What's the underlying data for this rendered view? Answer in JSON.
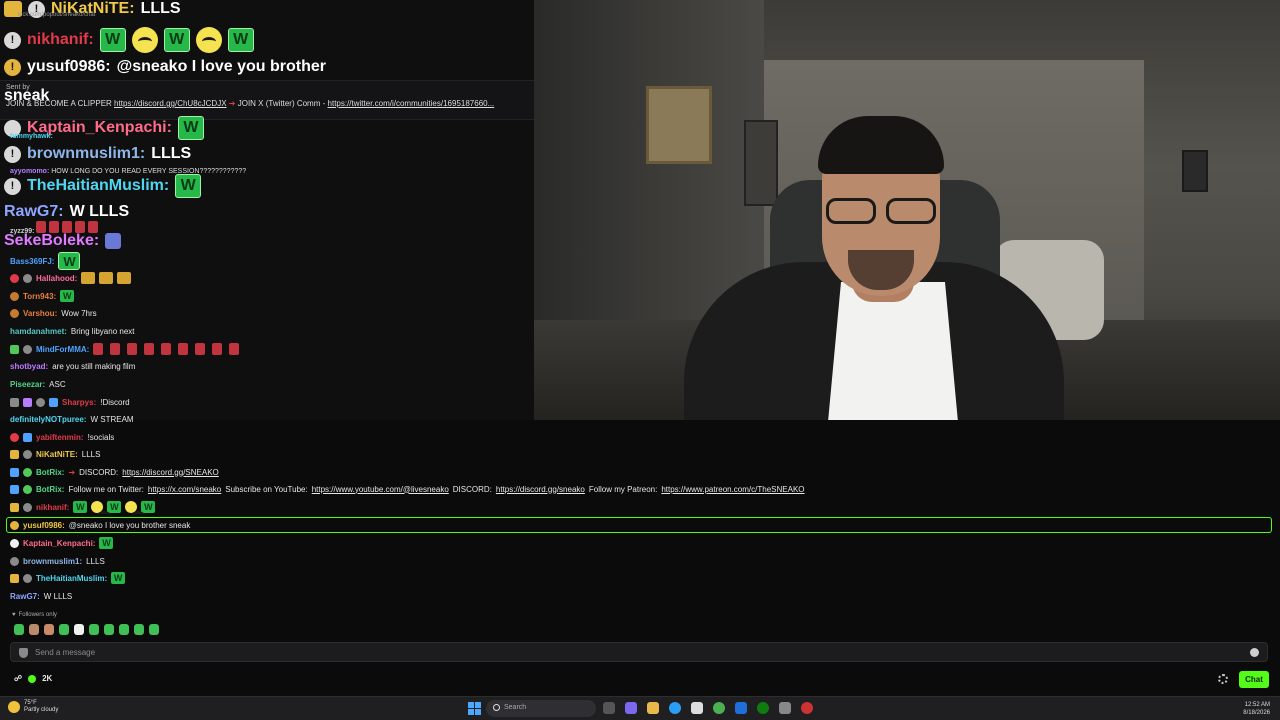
{
  "popout": {
    "url": "kick.com/popout/sneako/chat",
    "lines": [
      {
        "user": "NiKatNiTE:",
        "msg": "LLLS",
        "color": "#f0c94a"
      },
      {
        "user": "nikhanif:",
        "msg": "",
        "color": "#e23a4a"
      },
      {
        "user": "yusuf0986:",
        "msg": "@sneako I love you brother",
        "color": "#ffffff"
      }
    ],
    "banner": {
      "sent_by": "Sent by",
      "word": "sneak",
      "pinned_text": "JOIN & BECOME A CLIPPER",
      "pinned_link1": "https://discord.gg/ChU8cJCDJX",
      "pinned_mid": "JOIN X (Twitter) Comm -",
      "pinned_link2": "https://twitter.com/i/communities/1695187660..."
    },
    "big_lines": [
      {
        "user": "Kaptain_Kenpachi:",
        "msg": "",
        "color": "#ff6b8a"
      },
      {
        "user": "brownmuslim1:",
        "msg": "LLLS",
        "color": "#8fb6e8"
      },
      {
        "user": "TheHaitianMuslim:",
        "msg": "",
        "color": "#4fd6f0"
      },
      {
        "user": "RawG7:",
        "msg": "W LLLS",
        "color": "#8ea6ff"
      },
      {
        "user": "SekeBoleke:",
        "msg": "",
        "color": "#e07aff"
      }
    ],
    "small": [
      {
        "user": "tummyhawk:",
        "msg": ""
      },
      {
        "user": "ayyomomo:",
        "msg": "HOW LONG DO YOU READ EVERY SESSION????????????"
      },
      {
        "user": "zyzz99:",
        "msg": ""
      }
    ]
  },
  "chat": {
    "rows": [
      {
        "user": "Bass369FJ:",
        "msg": "",
        "color": "#4fa3ff"
      },
      {
        "user": "Hallahood:",
        "msg": "",
        "color": "#ff6b9a"
      },
      {
        "user": "Torn943:",
        "msg": "",
        "color": "#e87d3e"
      },
      {
        "user": "Varshou:",
        "msg": "Wow 7hrs",
        "color": "#e87d3e"
      },
      {
        "user": "hamdanahmet:",
        "msg": "Bring libyano next",
        "color": "#53c7c7"
      },
      {
        "user": "MindForMMA:",
        "msg": "",
        "color": "#4fa3ff"
      },
      {
        "user": "shotbyad:",
        "msg": "are you still making film",
        "color": "#b87cff"
      },
      {
        "user": "Piseezar:",
        "msg": "ASC",
        "color": "#53d68a"
      },
      {
        "user": "Sharpys:",
        "msg": "!Discord",
        "color": "#e23a4a"
      },
      {
        "user": "definitelyNOTpuree:",
        "msg": "W STREAM",
        "color": "#4fd6f0"
      },
      {
        "user": "yabiftenmin:",
        "msg": "!socials",
        "color": "#e23a4a"
      },
      {
        "user": "NiKatNiTE:",
        "msg": "LLLS",
        "color": "#f0c94a"
      }
    ],
    "botrix1": {
      "user": "BotRix:",
      "msg": "DISCORD:",
      "link": "https://discord.gg/SNEAKO"
    },
    "botrix2": {
      "user": "BotRix:",
      "p1": "Follow me on Twitter:",
      "l1": "https://x.com/sneako",
      "p2": "Subscribe on YouTube:",
      "l2": "https://www.youtube.com/@livesneako",
      "p3": "DISCORD:",
      "l3": "https://discord.gg/sneako",
      "p4": "Follow my Patreon:",
      "l4": "https://www.patreon.com/c/TheSNEAKO"
    },
    "nikhanif": {
      "user": "nikhanif:",
      "msg": ""
    },
    "highlighted": {
      "user": "yusuf0986:",
      "msg": "@sneako I love you brother sneak"
    },
    "after": [
      {
        "user": "Kaptain_Kenpachi:",
        "msg": "",
        "color": "#ff6b8a"
      },
      {
        "user": "brownmuslim1:",
        "msg": "LLLS",
        "color": "#8fb6e8"
      },
      {
        "user": "TheHaitianMuslim:",
        "msg": "",
        "color": "#4fd6f0"
      },
      {
        "user": "RawG7:",
        "msg": "W LLLS",
        "color": "#8ea6ff"
      }
    ],
    "followers_only": "Followers only",
    "placeholder": "Send a message",
    "viewers": "2K",
    "chat_button": "Chat"
  },
  "taskbar": {
    "temp": "75°F",
    "weather": "Partly cloudy",
    "search": "Search",
    "time": "12:52 AM",
    "date": "8/18/2026"
  },
  "colors": {
    "accent": "#53fc18",
    "emote_green": "#27b84a",
    "bg": "#0b0b0c"
  }
}
